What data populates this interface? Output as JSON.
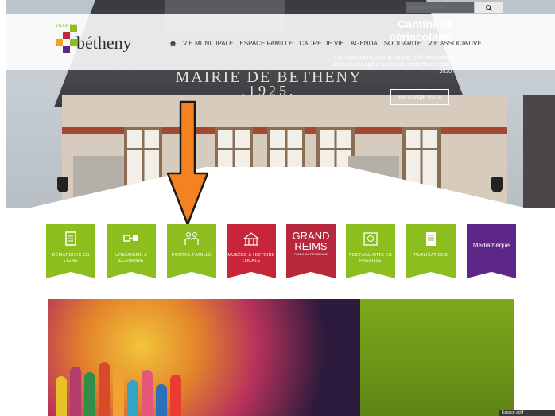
{
  "header": {
    "logo": {
      "prefix": "VILLE DE",
      "name": "bétheny"
    },
    "nav": [
      "VIE MUNICIPALE",
      "ESPACE FAMILLE",
      "CADRE DE VIE",
      "AGENDA",
      "SOLIDARITÉ",
      "VIE ASSOCIATIVE"
    ]
  },
  "search": {
    "placeholder": "Votre recherche..."
  },
  "hero": {
    "sign": "MAIRIE DE BETHENY",
    "year": ".1925."
  },
  "tiles": [
    {
      "label": "DÉMARCHES EN LIGNE",
      "color": "#8cbe1e",
      "icon": "document-icon"
    },
    {
      "label": "URBANISME & ÉCONOMIE",
      "color": "#8cbe1e",
      "icon": "tools-icon"
    },
    {
      "label": "PORTAIL FAMILLE",
      "color": "#8cbe1e",
      "icon": "family-icon"
    },
    {
      "label": "MUSÉES & HISTOIRE LOCALE",
      "color": "#c7253a",
      "icon": "museum-icon"
    },
    {
      "label": "GRAND REIMS",
      "sub": "COMMUNAUTÉ URBAINE",
      "color": "#b7283c",
      "icon": "grand-reims-logo"
    },
    {
      "label": "FESTIVAL ARTS en PAGAILLE",
      "color": "#8cbe1e",
      "icon": "festival-icon"
    },
    {
      "label": "PUBLICATIONS",
      "color": "#8cbe1e",
      "icon": "publication-icon"
    },
    {
      "label": "Médiathèque",
      "color": "#5c2787",
      "icon": "mediatheque-logo"
    }
  ],
  "banner": {
    "title_line1": "Cantine et",
    "title_line2": "périscolaire",
    "text": "Les inscriptions pour la cantine et le périscolaire sont ouvertes pour la période septembre-octobre 2020.",
    "button": "EN SAVOIR PLUS"
  },
  "footer": {
    "espace": "Espace actif"
  }
}
